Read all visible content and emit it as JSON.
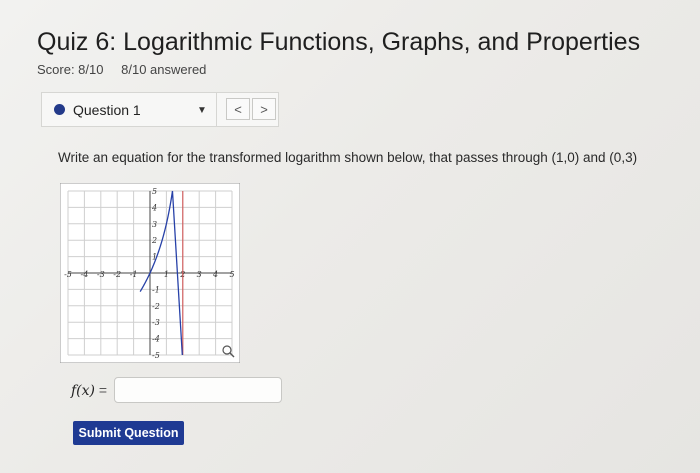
{
  "quiz": {
    "title": "Quiz 6: Logarithmic Functions, Graphs, and Properties",
    "score": "Score: 8/10",
    "answered": "8/10 answered"
  },
  "question_nav": {
    "label": "Question 1",
    "caret": "▼",
    "prev": "<",
    "next": ">"
  },
  "question": {
    "prompt": "Write an equation for the transformed logarithm shown below, that passes through (1,0) and (0,3)",
    "function_label": "f(x)",
    "equals": " =",
    "answer_value": ""
  },
  "graph": {
    "x_ticks": [
      "-5",
      "-4",
      "-3",
      "-2",
      "-1",
      "1",
      "2",
      "3",
      "4",
      "5"
    ],
    "y_ticks": [
      "5",
      "4",
      "3",
      "2",
      "1",
      "-1",
      "-2",
      "-3",
      "-4",
      "-5"
    ],
    "xlim": [
      -5,
      5
    ],
    "ylim": [
      -5,
      5
    ],
    "asymptote_x": 2,
    "points": [
      [
        1,
        0
      ],
      [
        0,
        3
      ]
    ],
    "zoom_icon": "magnifier-icon"
  },
  "submit": {
    "label": "Submit Question"
  },
  "colors": {
    "accent": "#1f3a93",
    "curve": "#2741a8",
    "asymptote": "#d04848"
  }
}
